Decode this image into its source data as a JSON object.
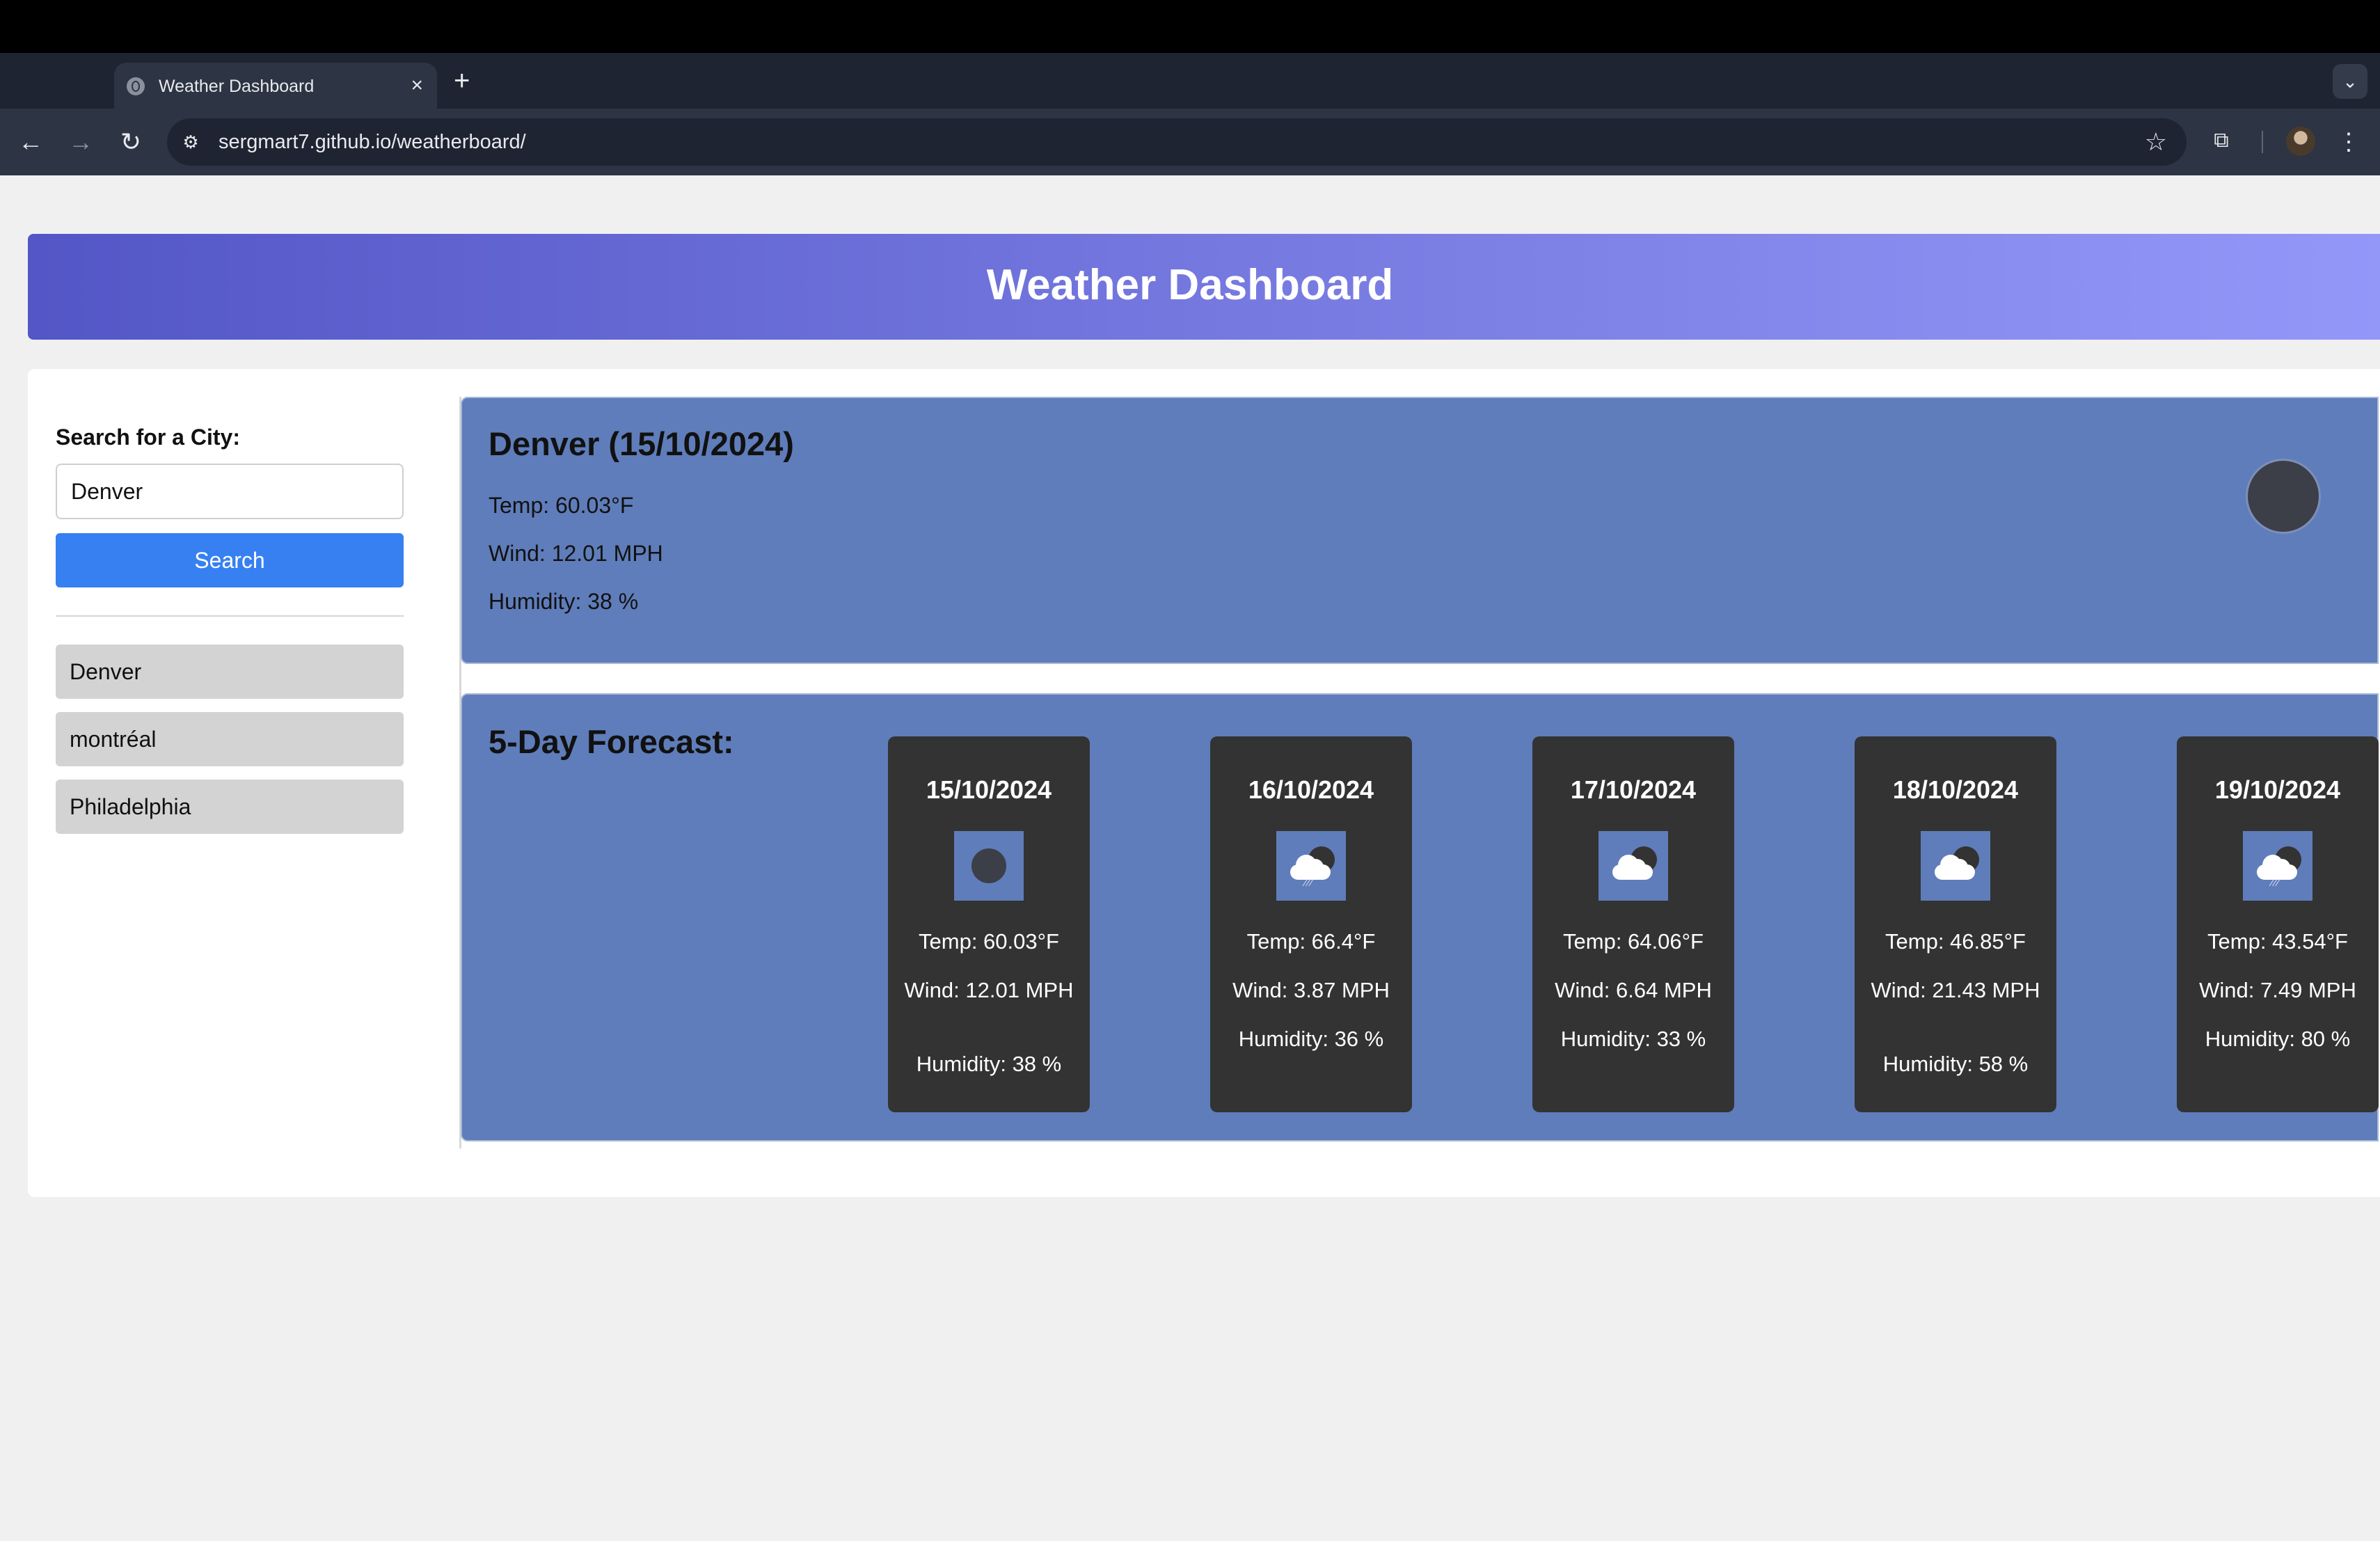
{
  "browser": {
    "tab_title": "Weather Dashboard",
    "tab_close": "×",
    "new_tab": "+",
    "tab_search": "⌄",
    "back": "←",
    "forward": "→",
    "reload": "↻",
    "url": "sergmart7.github.io/weatherboard/",
    "bookmark": "☆",
    "menu": "⋮"
  },
  "header": {
    "title": "Weather Dashboard"
  },
  "sidebar": {
    "search_label": "Search for a City:",
    "input_value": "Denver",
    "search_button": "Search",
    "history": [
      "Denver",
      "montréal",
      "Philadelphia"
    ]
  },
  "current": {
    "title": "Denver (15/10/2024)",
    "temp": "Temp: 60.03°F",
    "wind": "Wind: 12.01 MPH",
    "humidity": "Humidity: 38 %",
    "icon": "clear-night-icon"
  },
  "forecast": {
    "heading": "5-Day Forecast:",
    "days": [
      {
        "date": "15/10/2024",
        "icon": "clear-night-icon",
        "temp": "Temp: 60.03°F",
        "wind": "Wind: 12.01 MPH",
        "humidity": "Humidity: 38 %"
      },
      {
        "date": "16/10/2024",
        "icon": "rain-cloud-icon",
        "temp": "Temp: 66.4°F",
        "wind": "Wind: 3.87 MPH",
        "humidity": "Humidity: 36 %"
      },
      {
        "date": "17/10/2024",
        "icon": "cloudy-night-icon",
        "temp": "Temp: 64.06°F",
        "wind": "Wind: 6.64 MPH",
        "humidity": "Humidity: 33 %"
      },
      {
        "date": "18/10/2024",
        "icon": "cloudy-night-icon",
        "temp": "Temp: 46.85°F",
        "wind": "Wind: 21.43 MPH",
        "humidity": "Humidity: 58 %"
      },
      {
        "date": "19/10/2024",
        "icon": "rain-cloud-icon",
        "temp": "Temp: 43.54°F",
        "wind": "Wind: 7.49 MPH",
        "humidity": "Humidity: 80 %"
      }
    ]
  },
  "colors": {
    "header_gradient_start": "#5356c6",
    "header_gradient_end": "#9397f8",
    "panel_blue": "#5f7dba",
    "card_dark": "#333333",
    "button_blue": "#3680f2",
    "history_gray": "#d3d3d3"
  }
}
